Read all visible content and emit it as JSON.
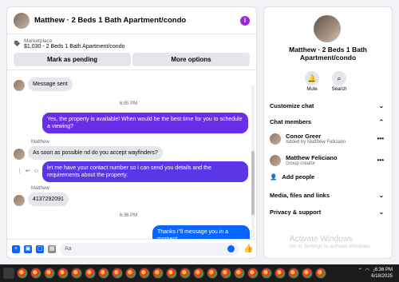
{
  "chat": {
    "title": "Matthew · 2 Beds 1 Bath Apartment/condo",
    "marketplace_label": "Marketplace",
    "marketplace_item": "$1,030 - 2 Beds 1 Bath Apartment/condo",
    "btn_pending": "Mark as pending",
    "btn_more": "More options"
  },
  "messages": {
    "m1": "Message sent",
    "ts1": "6:05 PM",
    "m2": "Yes, the property is available! When would be the best time for you to schedule a viewing?",
    "sender1": "Matthew",
    "m3": "As soon as possible nd do you accept wayfinders?",
    "m4": "let me have your contact number so i can send you details and the requirements about the property.",
    "sender2": "Matthew",
    "m5": "4137292091",
    "ts2": "6:36 PM",
    "m6": "Thanks i''ll message you in a moment"
  },
  "composer": {
    "placeholder": "Aa"
  },
  "info": {
    "title": "Matthew · 2 Beds 1 Bath Apartment/condo",
    "mute": "Mute",
    "search": "Search",
    "customize": "Customize chat",
    "members": "Chat members",
    "member1_name": "Conor Greer",
    "member1_sub": "Added by Matthew Feliciano",
    "member2_name": "Matthew Feliciano",
    "member2_sub": "Group creator",
    "add_people": "Add people",
    "media": "Media, files and links",
    "privacy": "Privacy & support"
  },
  "watermark": {
    "line1": "Activate Windows",
    "line2": "Go to Settings to activate Windows."
  },
  "taskbar": {
    "time": "6:36 PM",
    "date": "6/18/2025"
  },
  "colors": {
    "accent_purple": "#6a2ee8",
    "accent_blue": "#0866ff"
  }
}
